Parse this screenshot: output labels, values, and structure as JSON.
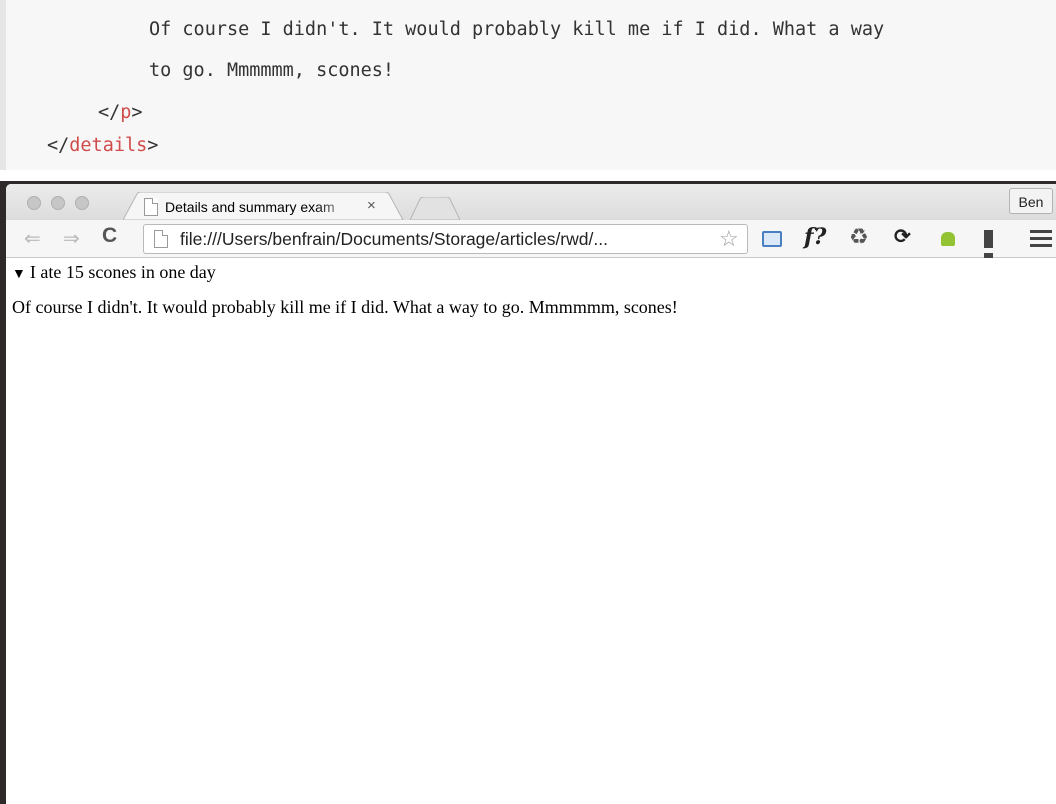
{
  "code": {
    "line1": "Of course I didn't. It would probably kill me if I did. What a way",
    "line2": "to go. Mmmmmm, scones!",
    "line3_open": "</",
    "line3_tag": "p",
    "line3_close": ">",
    "line4_open": "</",
    "line4_tag": "details",
    "line4_close": ">"
  },
  "browser": {
    "tab_title": "Details and summary exam",
    "tab_close": "×",
    "profile": "Ben",
    "back_glyph": "⇐",
    "forward_glyph": "⇒",
    "reload_glyph": "C",
    "url": "file:///Users/benfrain/Documents/Storage/articles/rwd/...",
    "star_glyph": "☆",
    "ext_f_label": "f?",
    "ext_recycle_glyph": "♻",
    "ext_sync_glyph": "⟳"
  },
  "page": {
    "summary_marker": "▼",
    "summary_text": "I ate 15 scones in one day",
    "paragraph": "Of course I didn't. It would probably kill me if I did. What a way to go. Mmmmmm, scones!"
  }
}
